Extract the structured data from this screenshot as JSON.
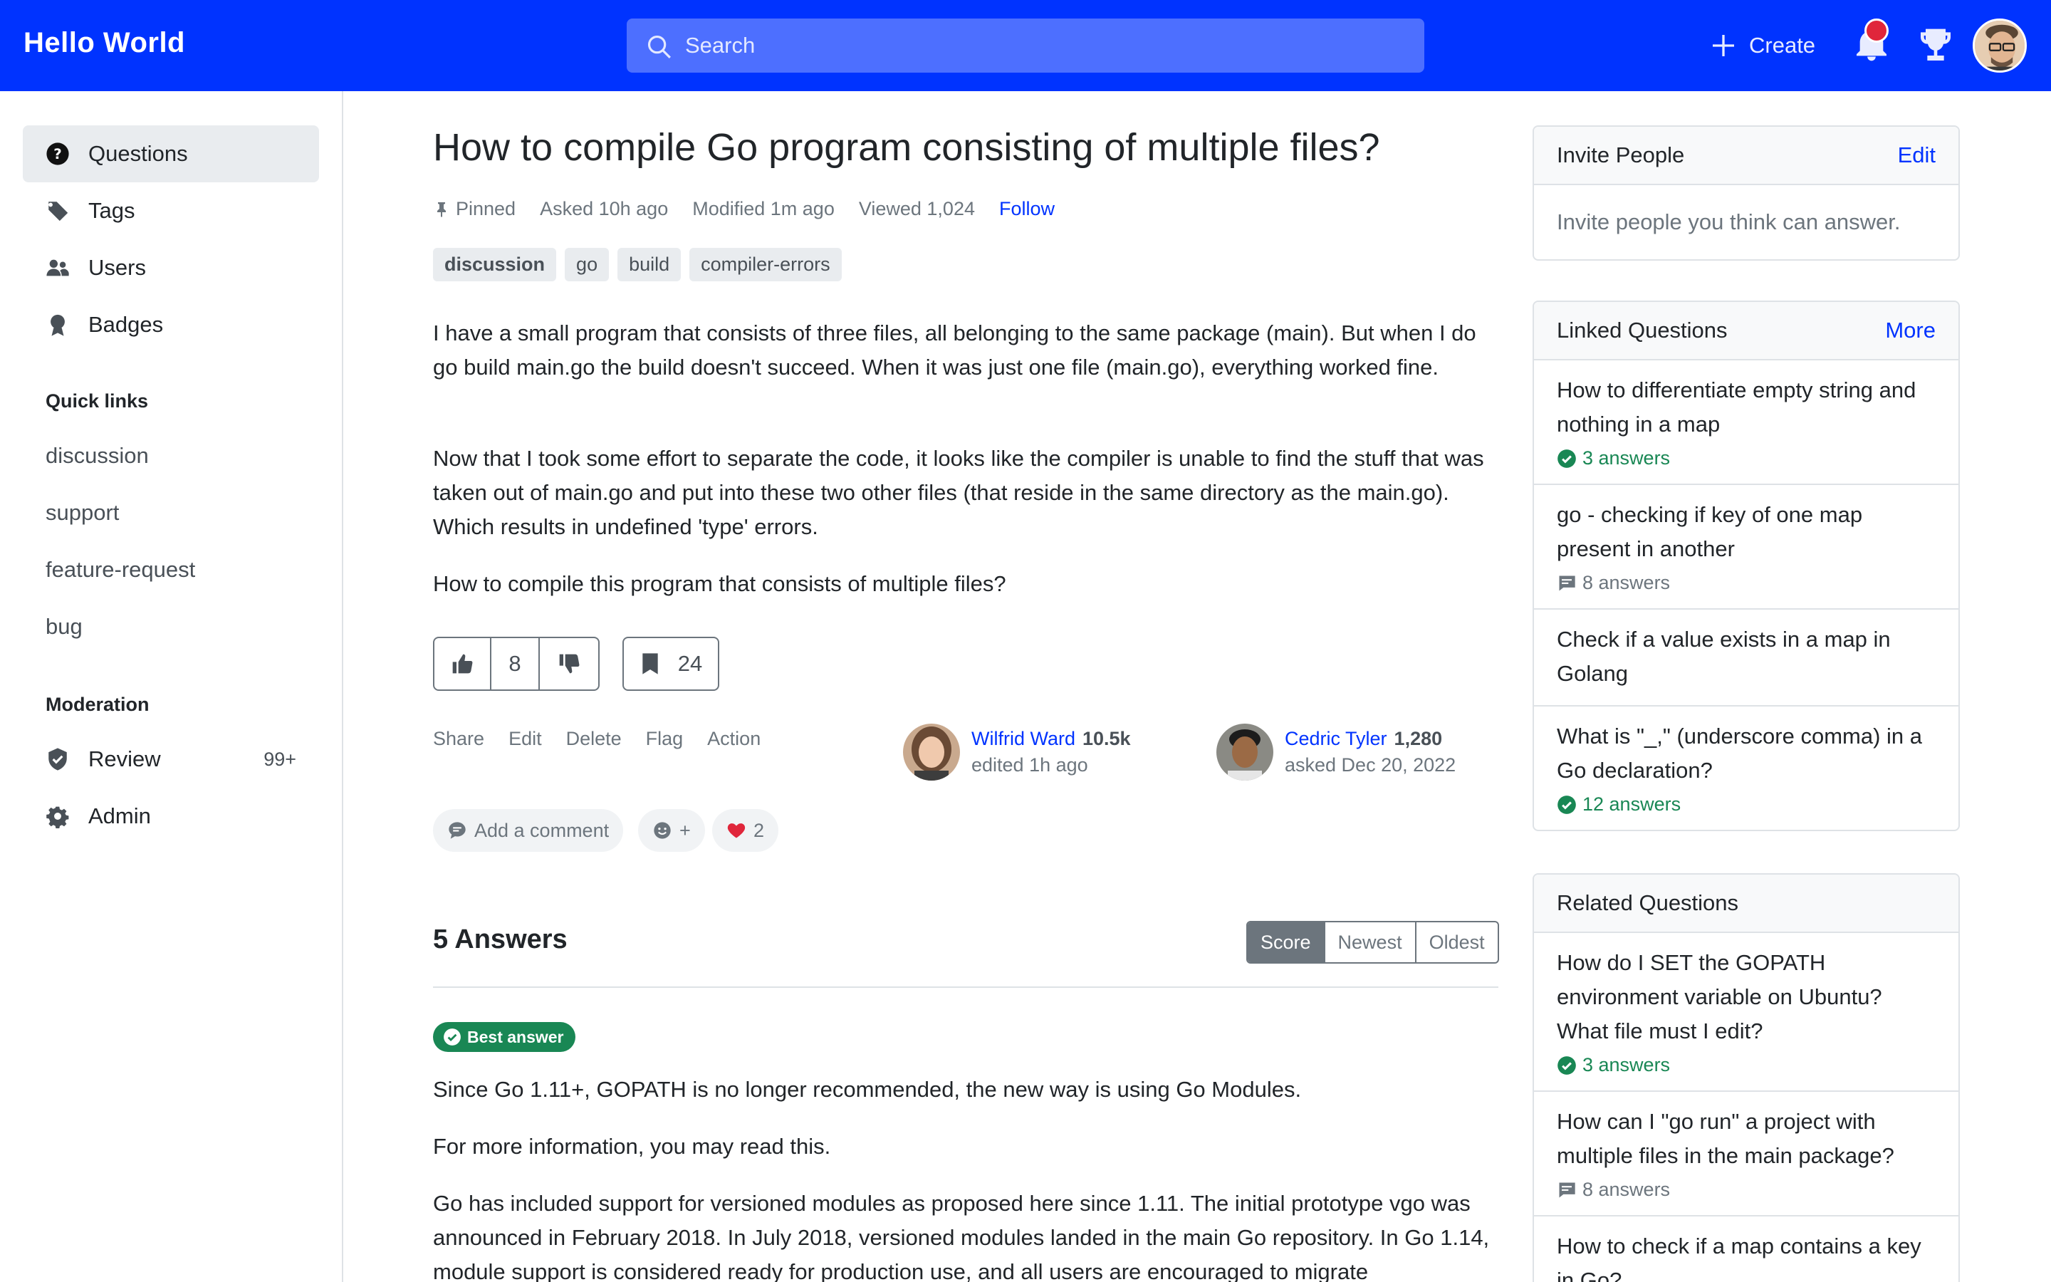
{
  "header": {
    "brand": "Hello World",
    "search_placeholder": "Search",
    "create_label": "Create"
  },
  "sidebar": {
    "nav": [
      {
        "label": "Questions",
        "icon": "question-circle-icon",
        "active": true
      },
      {
        "label": "Tags",
        "icon": "tag-icon"
      },
      {
        "label": "Users",
        "icon": "users-icon"
      },
      {
        "label": "Badges",
        "icon": "award-icon"
      }
    ],
    "quick_links_title": "Quick links",
    "quick_links": [
      "discussion",
      "support",
      "feature-request",
      "bug"
    ],
    "moderation_title": "Moderation",
    "moderation": [
      {
        "label": "Review",
        "icon": "shield-check-icon",
        "count": "99+"
      },
      {
        "label": "Admin",
        "icon": "gear-icon"
      }
    ]
  },
  "question": {
    "title": "How to compile Go program consisting of multiple files?",
    "pinned": "Pinned",
    "asked": "Asked 10h ago",
    "modified": "Modified 1m ago",
    "viewed": "Viewed 1,024",
    "follow": "Follow",
    "tags": [
      "discussion",
      "go",
      "build",
      "compiler-errors"
    ],
    "body": [
      "I have a small program that consists of three files, all belonging to the same package (main). But when I do go build main.go the build doesn't succeed. When it was just one file (main.go), everything worked fine.",
      "Now that I took some effort to separate the code, it looks like the compiler is unable to find the stuff that was taken out of main.go and put into these two other files (that reside in the same directory as the main.go). Which results in undefined 'type' errors.",
      "How to compile this program that consists of multiple files?"
    ],
    "votes": "8",
    "bookmarks": "24",
    "actions": [
      "Share",
      "Edit",
      "Delete",
      "Flag",
      "Action"
    ],
    "editor": {
      "name": "Wilfrid Ward",
      "rep": "10.5k",
      "sub": "edited 1h ago"
    },
    "author": {
      "name": "Cedric Tyler",
      "rep": "1,280",
      "sub": "asked Dec 20, 2022"
    },
    "add_comment": "Add a comment",
    "reaction_add": "+",
    "heart_count": "2"
  },
  "answers": {
    "title": "5 Answers",
    "sort": [
      "Score",
      "Newest",
      "Oldest"
    ],
    "best_label": "Best answer",
    "body": [
      "Since Go 1.11+, GOPATH is no longer recommended, the new way is using Go Modules.",
      "For more information, you may read this.",
      "Go has included support for versioned modules as proposed here since 1.11. The initial prototype vgo was announced in February 2018. In July 2018, versioned modules landed in the main Go repository. In Go 1.14, module support is considered ready for production use, and all users are encouraged to migrate"
    ]
  },
  "invite": {
    "title": "Invite People",
    "edit": "Edit",
    "text": "Invite people you think can answer."
  },
  "linked": {
    "title": "Linked Questions",
    "more": "More",
    "items": [
      {
        "title": "How to differentiate empty string and nothing in a map",
        "answers": "3 answers",
        "accepted": true
      },
      {
        "title": "go - checking if key of one map present in another",
        "answers": "8 answers",
        "accepted": false
      },
      {
        "title": "Check if a value exists in a map in Golang",
        "answers": "",
        "accepted": false
      },
      {
        "title": "What is \"_,\" (underscore comma) in a Go declaration?",
        "answers": "12 answers",
        "accepted": true
      }
    ]
  },
  "related": {
    "title": "Related Questions",
    "items": [
      {
        "title": "How do I SET the GOPATH environment variable on Ubuntu? What file must I edit?",
        "answers": "3 answers",
        "accepted": true
      },
      {
        "title": "How can I \"go run\" a project with multiple files in the main package?",
        "answers": "8 answers",
        "accepted": false
      },
      {
        "title": "How to check if a map contains a key in Go?",
        "answers": "",
        "accepted": false
      }
    ]
  },
  "colors": {
    "brand": "#0033ff",
    "accepted": "#198754",
    "notification": "#e0263b"
  }
}
